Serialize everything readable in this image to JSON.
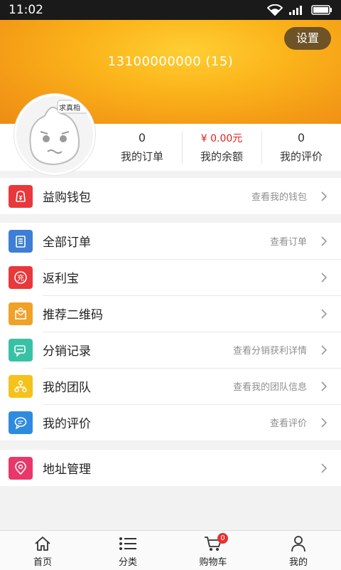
{
  "statusbar": {
    "time": "11:02"
  },
  "header": {
    "settings_label": "设置",
    "username": "13100000000 (15)",
    "avatar_tag": "求真相"
  },
  "stats": [
    {
      "value": "0",
      "label": "我的订单"
    },
    {
      "value": "¥ 0.00元",
      "label": "我的余额"
    },
    {
      "value": "0",
      "label": "我的评价"
    }
  ],
  "wallet": {
    "label": "益购钱包",
    "hint": "查看我的钱包",
    "icon": "wallet-icon",
    "color": "#e8383b"
  },
  "menu": [
    {
      "label": "全部订单",
      "hint": "查看订单",
      "icon": "order-list-icon",
      "color": "#3d7ed6"
    },
    {
      "label": "返利宝",
      "hint": "",
      "icon": "rebate-icon",
      "color": "#e8383b"
    },
    {
      "label": "推荐二维码",
      "hint": "",
      "icon": "qrcode-envelope-icon",
      "color": "#f0a128"
    },
    {
      "label": "分销记录",
      "hint": "查看分销获利详情",
      "icon": "chat-record-icon",
      "color": "#39c1a6"
    },
    {
      "label": "我的团队",
      "hint": "查看我的团队信息",
      "icon": "team-icon",
      "color": "#f4c21c"
    },
    {
      "label": "我的评价",
      "hint": "查看评价",
      "icon": "comment-icon",
      "color": "#2f8be0"
    }
  ],
  "address": {
    "label": "地址管理",
    "hint": "",
    "icon": "location-icon",
    "color": "#e8386a"
  },
  "tabbar": {
    "tabs": [
      {
        "label": "首页",
        "icon": "home-icon"
      },
      {
        "label": "分类",
        "icon": "category-icon"
      },
      {
        "label": "购物车",
        "icon": "cart-icon",
        "badge": "0"
      },
      {
        "label": "我的",
        "icon": "profile-icon"
      }
    ]
  }
}
